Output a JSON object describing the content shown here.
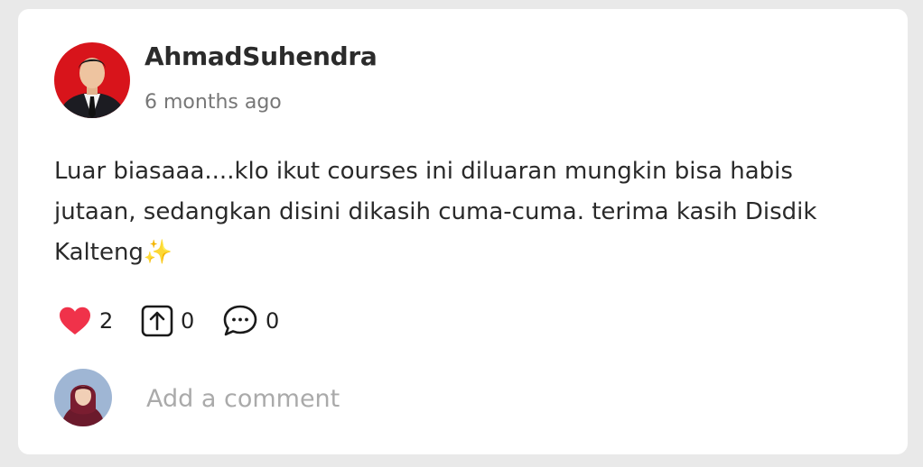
{
  "post": {
    "author": "AhmadSuhendra",
    "time": "6 months ago",
    "text": "Luar biasaaa....klo ikut courses ini diluaran mungkin bisa habis jutaan, sedangkan disini dikasih cuma-cuma. terima kasih Disdik Kalteng✨"
  },
  "actions": {
    "like_icon": "heart-icon",
    "like_count": "2",
    "like_color": "#f0324a",
    "share_icon": "share-upload-icon",
    "share_count": "0",
    "reply_icon": "chat-bubble-icon",
    "reply_count": "0"
  },
  "comment": {
    "placeholder": "Add a comment"
  }
}
